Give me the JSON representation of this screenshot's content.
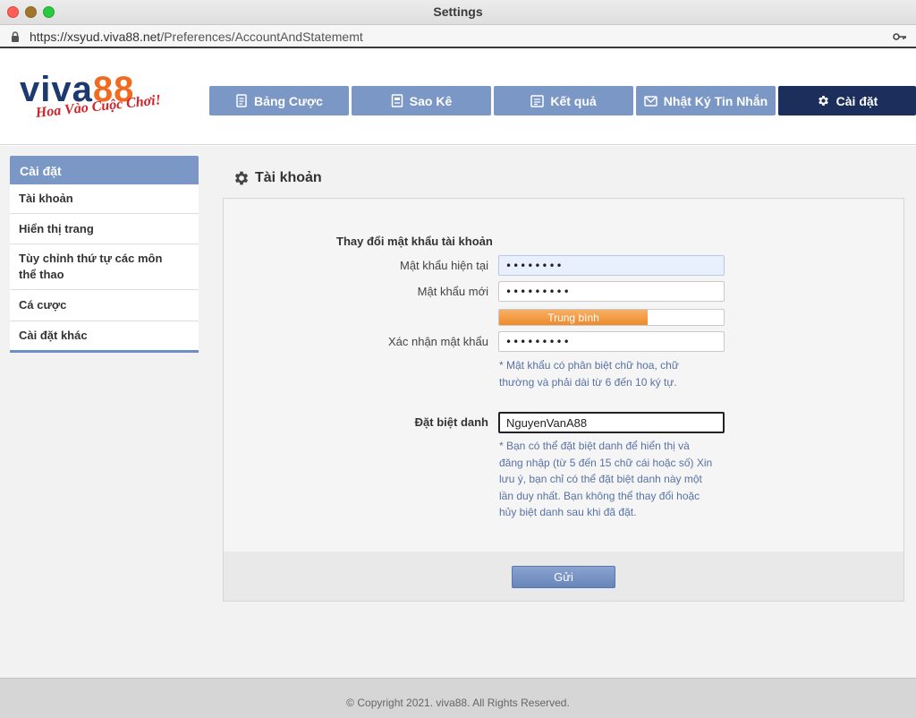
{
  "window": {
    "title": "Settings",
    "url_base": "https://xsyud.viva88.net",
    "url_path": "/Preferences/AccountAndStatememt"
  },
  "logo": {
    "brand_left": "viva",
    "brand_right": "88",
    "slogan": "Hoa Vào Cuộc Chơi!",
    "colors": {
      "primary": "#1d3a6e",
      "accent": "#f26a20",
      "slogan": "#d2232a"
    }
  },
  "nav": [
    {
      "label": "Bảng Cược",
      "icon": "receipt-icon",
      "active": false
    },
    {
      "label": "Sao Kê",
      "icon": "statement-icon",
      "active": false
    },
    {
      "label": "Kết quả",
      "icon": "results-icon",
      "active": false
    },
    {
      "label": "Nhật Ký Tin Nhắn",
      "icon": "envelope-icon",
      "active": false
    },
    {
      "label": "Cài đặt",
      "icon": "gear-icon",
      "active": true
    }
  ],
  "sidebar": {
    "title": "Cài đặt",
    "items": [
      {
        "label": "Tài khoản",
        "line2": ""
      },
      {
        "label": "Hiển thị trang",
        "line2": ""
      },
      {
        "label": "Tùy chỉnh thứ tự các môn",
        "line2": "thể thao"
      },
      {
        "label": "Cá cược",
        "line2": ""
      },
      {
        "label": "Cài đặt khác",
        "line2": ""
      }
    ]
  },
  "page": {
    "title": "Tài khoản",
    "password_section": "Thay đổi mật khẩu tài khoản",
    "current_password_label": "Mật khẩu hiện tại",
    "current_password_value": "••••••••",
    "new_password_label": "Mật khẩu mới",
    "new_password_value": "•••••••••",
    "strength_label": "Trung bình",
    "strength_level": 0.6,
    "confirm_password_label": "Xác nhận mật khẩu",
    "confirm_password_value": "•••••••••",
    "password_hint_line1": "* Mật khẩu có phân biệt chữ hoa, chữ",
    "password_hint_line2": "thường và phải dài từ 6 đến 10 ký tự.",
    "nickname_label": "Đặt biệt danh",
    "nickname_value": "NguyenVanA88",
    "nickname_hint_lines": [
      "* Bạn có thể đặt biệt danh để hiển thị và",
      "đăng nhập (từ 5 đến 15 chữ cái hoặc số) Xin",
      "lưu ý, bạn chỉ có thể đặt biệt danh này một",
      "lần duy nhất. Bạn không thể thay đổi hoặc",
      "hủy biệt danh sau khi đã đặt."
    ],
    "submit_label": "Gửi"
  },
  "footer": {
    "copyright": "© Copyright 2021. viva88. All Rights Reserved."
  }
}
